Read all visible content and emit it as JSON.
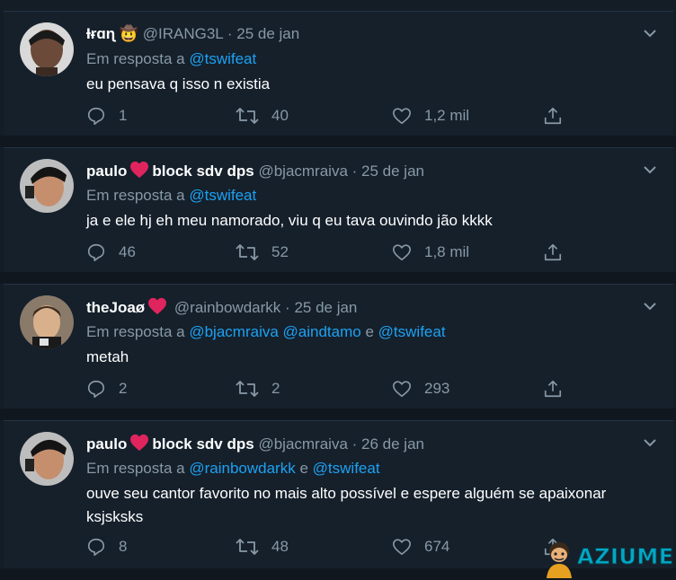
{
  "reply_prefix": "Em resposta a",
  "tweets": [
    {
      "name": "Ɨɍɑɳ",
      "emoji": "🤠",
      "handle": "@IRANG3L",
      "date": "25 de jan",
      "reply_to": [
        "@tswifeat"
      ],
      "reply_joiners": [],
      "text": "eu pensava q isso n existia",
      "replies": "1",
      "retweets": "40",
      "likes": "1,2 mil"
    },
    {
      "name": "paulo",
      "name_suffix": "block sdv dps",
      "handle": "@bjacmraiva",
      "date": "25 de jan",
      "reply_to": [
        "@tswifeat"
      ],
      "reply_joiners": [],
      "text": "ja e ele hj eh meu namorado, viu q eu tava ouvindo jão kkkk",
      "replies": "46",
      "retweets": "52",
      "likes": "1,8 mil"
    },
    {
      "name": "theJoaø",
      "handle": "@rainbowdarkk",
      "date": "25 de jan",
      "reply_to": [
        "@bjacmraiva",
        "@aindtamo",
        "@tswifeat"
      ],
      "reply_joiners": [
        "",
        "e"
      ],
      "text": "metah",
      "replies": "2",
      "retweets": "2",
      "likes": "293"
    },
    {
      "name": "paulo",
      "name_suffix": "block sdv dps",
      "handle": "@bjacmraiva",
      "date": "26 de jan",
      "reply_to": [
        "@rainbowdarkk",
        "@tswifeat"
      ],
      "reply_joiners": [
        "e"
      ],
      "text": "ouve seu cantor favorito no mais alto possível e espere alguém se apaixonar ksjsksks",
      "replies": "8",
      "retweets": "48",
      "likes": "674"
    }
  ],
  "watermark": "AZIUME",
  "colors": {
    "background": "#15202b",
    "divider": "#10171e",
    "secondary_text": "#8899a6",
    "link": "#1da1f2",
    "heart": "#e0245e"
  },
  "icons": {
    "reply": "reply-icon",
    "retweet": "retweet-icon",
    "like": "like-icon",
    "share": "share-icon",
    "caret": "chevron-down-icon"
  }
}
